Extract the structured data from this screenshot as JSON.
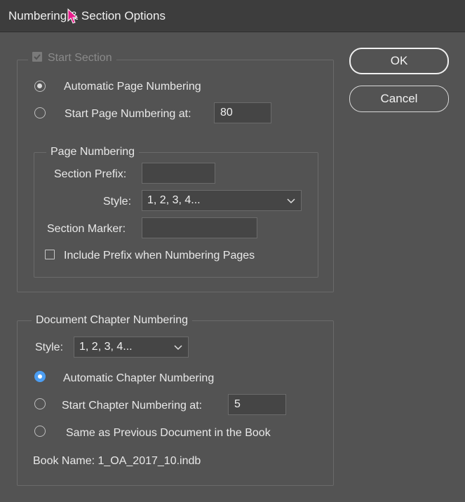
{
  "window": {
    "title": "Numbering & Section Options"
  },
  "buttons": {
    "ok": "OK",
    "cancel": "Cancel"
  },
  "section": {
    "start_section_label": "Start Section",
    "start_section_checked": true,
    "auto_page_numbering_label": "Automatic Page Numbering",
    "auto_page_numbering_selected": true,
    "start_page_numbering_label": "Start Page Numbering at:",
    "start_page_numbering_value": "80",
    "page_numbering": {
      "legend": "Page Numbering",
      "section_prefix_label": "Section Prefix:",
      "section_prefix_value": "",
      "style_label": "Style:",
      "style_value": "1, 2, 3, 4...",
      "section_marker_label": "Section Marker:",
      "section_marker_value": "",
      "include_prefix_label": "Include Prefix when Numbering Pages",
      "include_prefix_checked": false
    }
  },
  "chapter": {
    "legend": "Document Chapter Numbering",
    "style_label": "Style:",
    "style_value": "1, 2, 3, 4...",
    "auto_chapter_label": "Automatic Chapter Numbering",
    "auto_chapter_selected": true,
    "start_chapter_label": "Start Chapter Numbering at:",
    "start_chapter_value": "5",
    "same_as_previous_label": "Same as Previous Document in the Book",
    "book_name_label": "Book Name: 1_OA_2017_10.indb"
  },
  "colors": {
    "accent": "#4c9ef3",
    "background": "#535353",
    "titlebar": "#3d3d3d",
    "cursor": "#e81e8c"
  }
}
